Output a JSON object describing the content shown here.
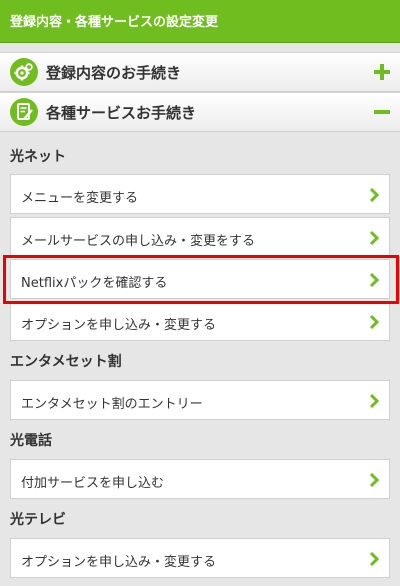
{
  "header": {
    "title": "登録内容・各種サービスの設定変更"
  },
  "accordions": [
    {
      "label": "登録内容のお手続き",
      "icon": "gear-icon",
      "state": "collapsed",
      "sign": "plus-icon"
    },
    {
      "label": "各種サービスお手続き",
      "icon": "edit-document-icon",
      "state": "expanded",
      "sign": "minus-icon"
    }
  ],
  "sections": [
    {
      "title": "光ネット",
      "items": [
        "メニューを変更する",
        "メールサービスの申し込み・変更をする",
        "Netflixパックを確認する",
        "オプションを申し込み・変更する"
      ]
    },
    {
      "title": "エンタメセット割",
      "items": [
        "エンタメセット割のエントリー"
      ]
    },
    {
      "title": "光電話",
      "items": [
        "付加サービスを申し込む"
      ]
    },
    {
      "title": "光テレビ",
      "items": [
        "オプションを申し込み・変更する"
      ]
    }
  ],
  "highlighted_item": "Netflixパックを確認する",
  "colors": {
    "accent": "#6fbd1e",
    "highlight": "#ee0000"
  }
}
